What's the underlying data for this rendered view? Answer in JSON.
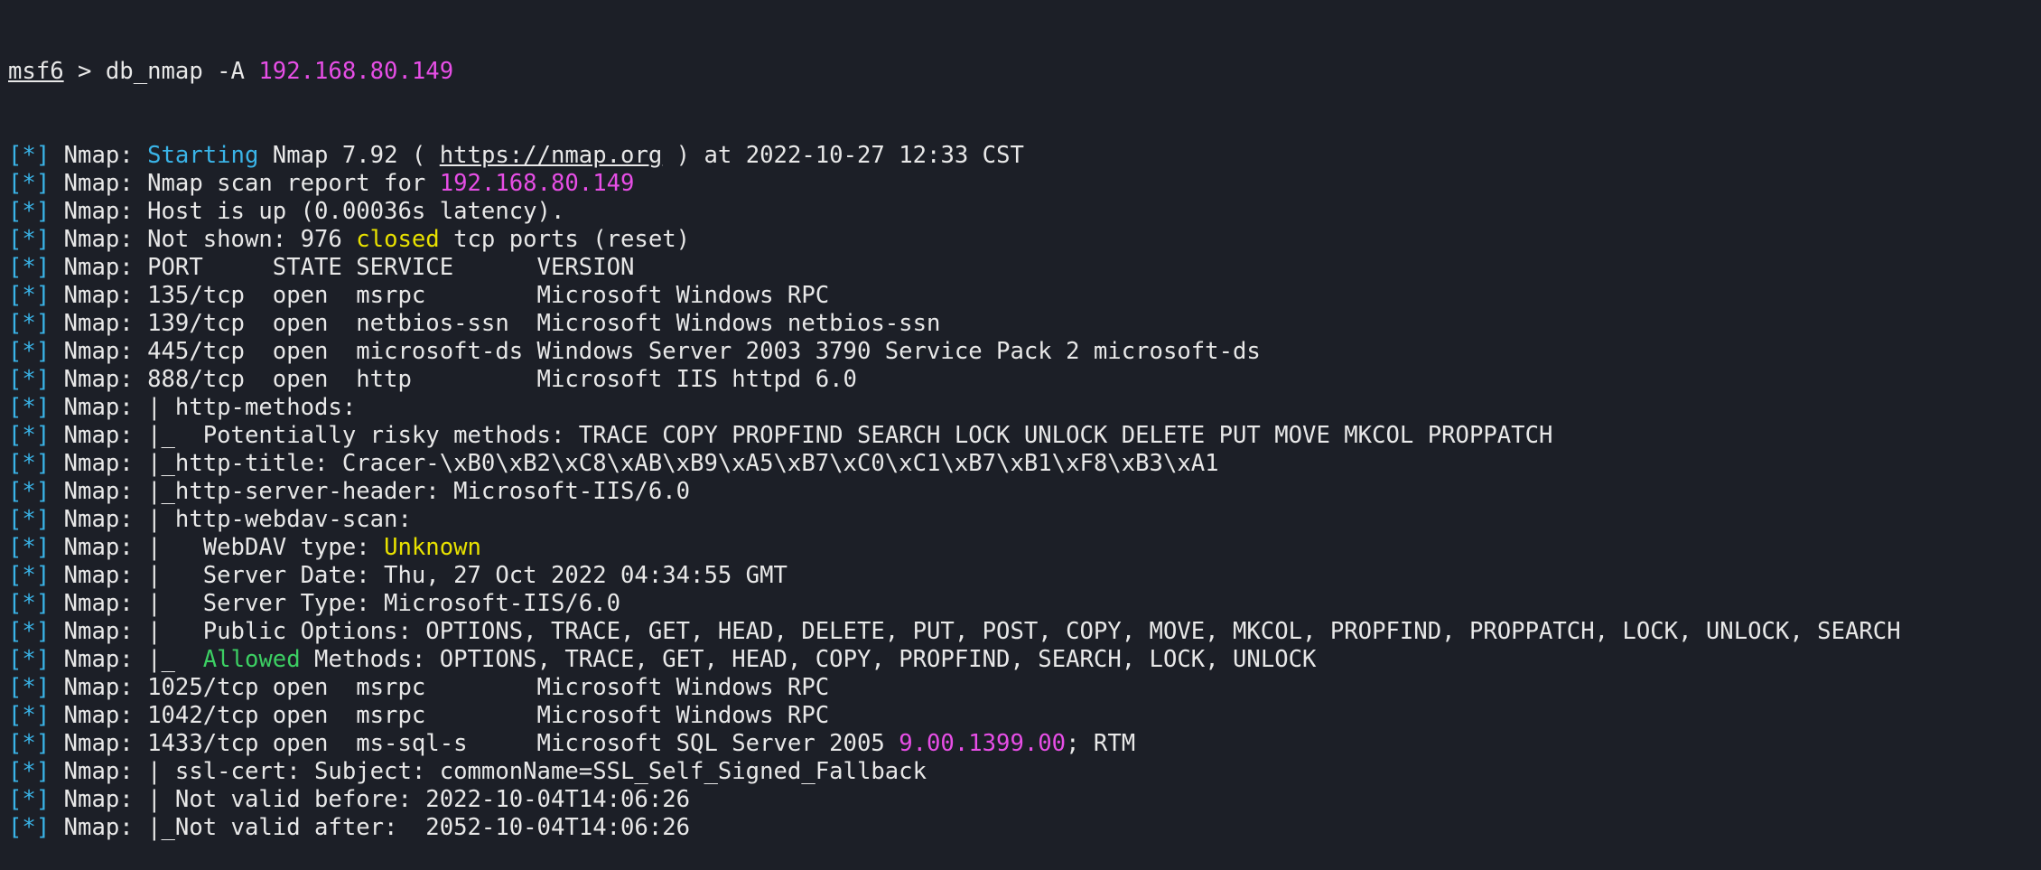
{
  "colors": {
    "background": "#1c1f27",
    "text": "#e8e8e8",
    "status_tag": "#3ab4e8",
    "ip_address": "#e74ee6",
    "closed_keyword": "#e8e100",
    "allowed_keyword": "#3ccf63"
  },
  "command": {
    "prompt": "msf6",
    "separator": " > ",
    "command_text": "db_nmap -A ",
    "target_ip": "192.168.80.149"
  },
  "output": {
    "tag": "[*]",
    "prefix": " Nmap: ",
    "lines": [
      {
        "segments": [
          {
            "text": "Starting",
            "color": "cyan"
          },
          {
            "text": " Nmap 7.92 ( "
          },
          {
            "text": "https://nmap.org",
            "underline": true
          },
          {
            "text": " ) at 2022-10-27 12:33 CST"
          }
        ]
      },
      {
        "segments": [
          {
            "text": "Nmap scan report for "
          },
          {
            "text": "192.168.80.149",
            "color": "pink"
          }
        ]
      },
      {
        "segments": [
          {
            "text": "Host is up (0.00036s latency)."
          }
        ]
      },
      {
        "segments": [
          {
            "text": "Not shown: 976 "
          },
          {
            "text": "closed",
            "color": "yellow"
          },
          {
            "text": " tcp ports (reset)"
          }
        ]
      },
      {
        "segments": [
          {
            "text": "PORT     STATE SERVICE      VERSION"
          }
        ]
      },
      {
        "segments": [
          {
            "text": "135/tcp  open  msrpc        Microsoft Windows RPC"
          }
        ]
      },
      {
        "segments": [
          {
            "text": "139/tcp  open  netbios-ssn  Microsoft Windows netbios-ssn"
          }
        ]
      },
      {
        "segments": [
          {
            "text": "445/tcp  open  microsoft-ds Windows Server 2003 3790 Service Pack 2 microsoft-ds"
          }
        ]
      },
      {
        "segments": [
          {
            "text": "888/tcp  open  http         Microsoft IIS httpd 6.0"
          }
        ]
      },
      {
        "segments": [
          {
            "text": "| http-methods: "
          }
        ]
      },
      {
        "segments": [
          {
            "text": "|_  Potentially risky methods: TRACE COPY PROPFIND SEARCH LOCK UNLOCK DELETE PUT MOVE MKCOL PROPPATCH"
          }
        ]
      },
      {
        "segments": [
          {
            "text": "|_http-title: Cracer-\\xB0\\xB2\\xC8\\xAB\\xB9\\xA5\\xB7\\xC0\\xC1\\xB7\\xB1\\xF8\\xB3\\xA1"
          }
        ]
      },
      {
        "segments": [
          {
            "text": "|_http-server-header: Microsoft-IIS/6.0"
          }
        ]
      },
      {
        "segments": [
          {
            "text": "| http-webdav-scan: "
          }
        ]
      },
      {
        "segments": [
          {
            "text": "|   WebDAV type: "
          },
          {
            "text": "Unknown",
            "color": "yellow"
          }
        ]
      },
      {
        "segments": [
          {
            "text": "|   Server Date: Thu, 27 Oct 2022 04:34:55 GMT"
          }
        ]
      },
      {
        "segments": [
          {
            "text": "|   Server Type: Microsoft-IIS/6.0"
          }
        ]
      },
      {
        "segments": [
          {
            "text": "|   Public Options: OPTIONS, TRACE, GET, HEAD, DELETE, PUT, POST, COPY, MOVE, MKCOL, PROPFIND, PROPPATCH, LOCK, UNLOCK, SEARCH"
          }
        ]
      },
      {
        "segments": [
          {
            "text": "|_  "
          },
          {
            "text": "Allowed",
            "color": "green"
          },
          {
            "text": " Methods: OPTIONS, TRACE, GET, HEAD, COPY, PROPFIND, SEARCH, LOCK, UNLOCK"
          }
        ]
      },
      {
        "segments": [
          {
            "text": "1025/tcp open  msrpc        Microsoft Windows RPC"
          }
        ]
      },
      {
        "segments": [
          {
            "text": "1042/tcp open  msrpc        Microsoft Windows RPC"
          }
        ]
      },
      {
        "segments": [
          {
            "text": "1433/tcp open  ms-sql-s     Microsoft SQL Server 2005 "
          },
          {
            "text": "9.00.1399.00",
            "color": "pink"
          },
          {
            "text": "; RTM"
          }
        ]
      },
      {
        "segments": [
          {
            "text": "| ssl-cert: Subject: commonName=SSL_Self_Signed_Fallback"
          }
        ]
      },
      {
        "segments": [
          {
            "text": "| Not valid before: 2022-10-04T14:06:26"
          }
        ]
      },
      {
        "segments": [
          {
            "text": "|_Not valid after:  2052-10-04T14:06:26"
          }
        ]
      }
    ]
  }
}
